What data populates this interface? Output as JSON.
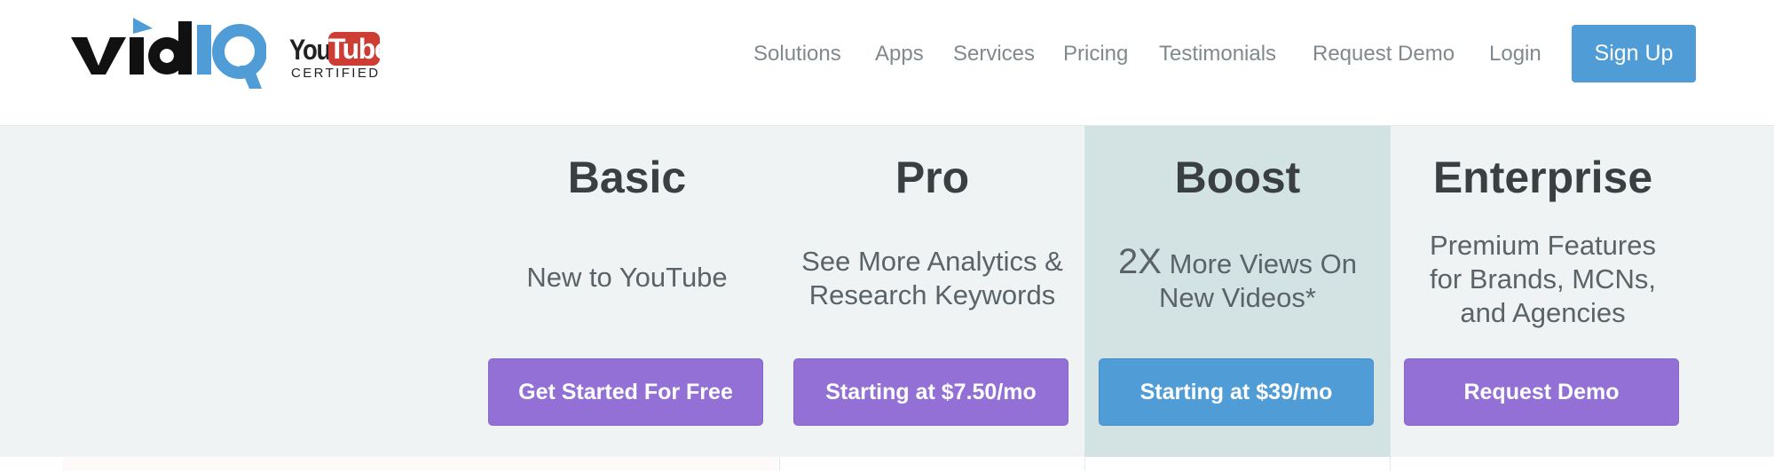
{
  "brand": {
    "logo_text": "vidIQ",
    "badge": {
      "you": "You",
      "tube": "Tube",
      "certified": "CERTIFIED"
    }
  },
  "nav": {
    "items": [
      "Solutions",
      "Apps",
      "Services",
      "Pricing",
      "Testimonials",
      "Request Demo",
      "Login"
    ],
    "signup_label": "Sign Up"
  },
  "colors": {
    "primary_blue": "#4f9cd7",
    "purple": "#9370d6",
    "boost_highlight": "#d3e2e3",
    "band": "#eff3f4",
    "youtube_red": "#cd3d33"
  },
  "plans": [
    {
      "name": "Basic",
      "desc_lines": [
        "New to YouTube"
      ],
      "cta": "Get Started For Free",
      "cta_color": "purple"
    },
    {
      "name": "Pro",
      "desc_lines": [
        "See More Analytics &",
        "Research Keywords"
      ],
      "cta": "Starting at $7.50/mo",
      "cta_color": "purple"
    },
    {
      "name": "Boost",
      "desc_big": "2X",
      "desc_lines": [
        "More Views On",
        "New Videos*"
      ],
      "cta": "Starting at $39/mo",
      "cta_color": "blue",
      "highlighted": true
    },
    {
      "name": "Enterprise",
      "desc_lines": [
        "Premium Features",
        "for Brands, MCNs,",
        "and Agencies"
      ],
      "cta": "Request Demo",
      "cta_color": "purple"
    }
  ]
}
